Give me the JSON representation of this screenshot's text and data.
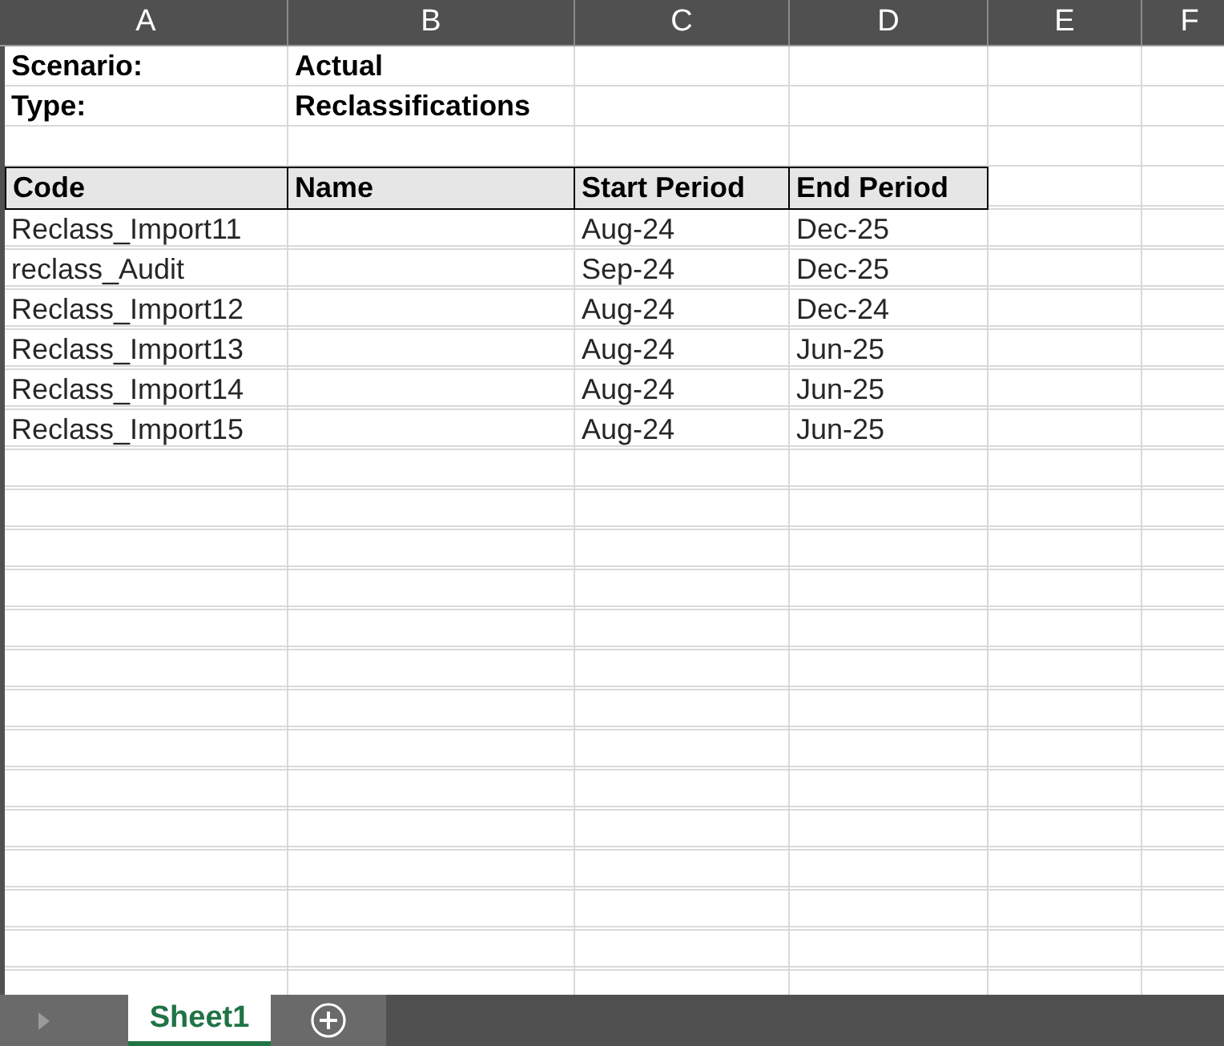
{
  "columns": [
    "A",
    "B",
    "C",
    "D",
    "E",
    "F"
  ],
  "info": [
    {
      "label": "Scenario:",
      "value": "Actual"
    },
    {
      "label": "Type:",
      "value": "Reclassifications"
    }
  ],
  "table": {
    "columns": [
      "Code",
      "Name",
      "Start Period",
      "End Period"
    ],
    "rows": [
      [
        "Reclass_Import11",
        "",
        "Aug-24",
        "Dec-25"
      ],
      [
        "reclass_Audit",
        "",
        "Sep-24",
        "Dec-25"
      ],
      [
        "Reclass_Import12",
        "",
        "Aug-24",
        "Dec-24"
      ],
      [
        "Reclass_Import13",
        "",
        "Aug-24",
        "Jun-25"
      ],
      [
        "Reclass_Import14",
        "",
        "Aug-24",
        "Jun-25"
      ],
      [
        "Reclass_Import15",
        "",
        "Aug-24",
        "Jun-25"
      ]
    ]
  },
  "sheet_tabs": [
    {
      "label": "Sheet1",
      "selected": true
    }
  ]
}
